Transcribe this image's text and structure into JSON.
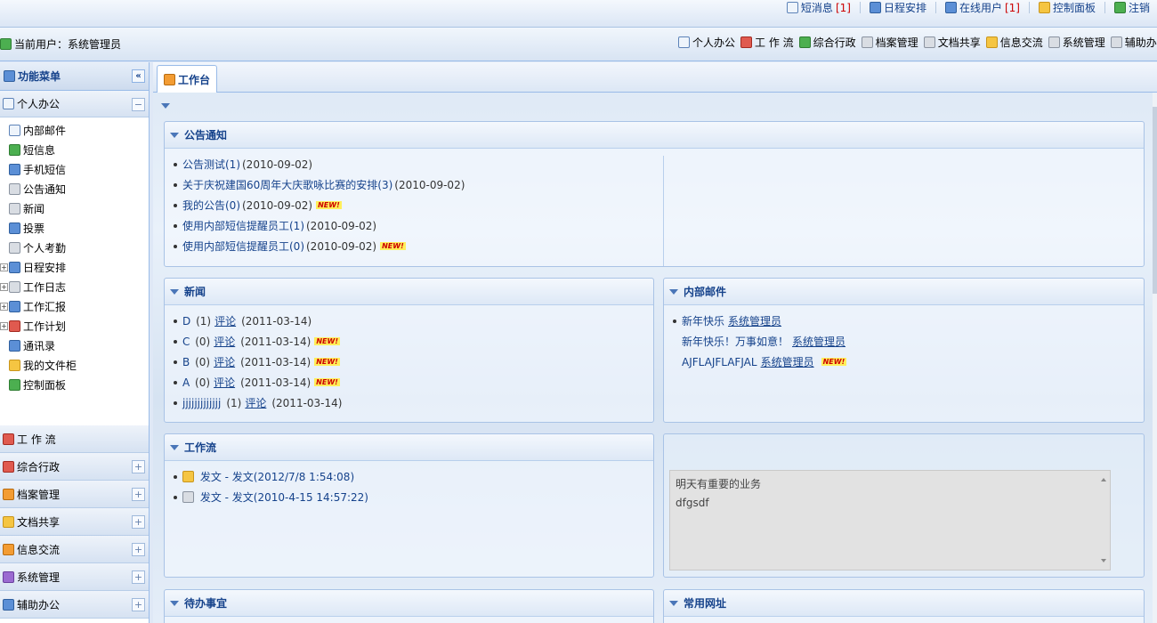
{
  "topbar": {
    "links": [
      {
        "label": "短消息",
        "count": "[1]",
        "icon": "envelope-icon"
      },
      {
        "label": "日程安排",
        "count": "",
        "icon": "calendar-icon"
      },
      {
        "label": "在线用户",
        "count": "[1]",
        "icon": "user-icon"
      },
      {
        "label": "控制面板",
        "count": "",
        "icon": "key-icon"
      },
      {
        "label": "注销",
        "count": "",
        "icon": "logout-icon"
      }
    ]
  },
  "userbar": {
    "current_user_label": "当前用户：系统管理员",
    "modules": [
      {
        "label": "个人办公",
        "icon": "mail-icon"
      },
      {
        "label": "工 作 流",
        "icon": "form-icon"
      },
      {
        "label": "综合行政",
        "icon": "people-icon"
      },
      {
        "label": "档案管理",
        "icon": "archive-icon"
      },
      {
        "label": "文档共享",
        "icon": "document-icon"
      },
      {
        "label": "信息交流",
        "icon": "chat-icon"
      },
      {
        "label": "系统管理",
        "icon": "gear-icon"
      },
      {
        "label": "辅助办公",
        "icon": "tools-icon"
      }
    ]
  },
  "sidebar": {
    "title": "功能菜单",
    "collapse_symbol": "«",
    "active_section": {
      "label": "个人办公",
      "toggle": "−"
    },
    "tree": [
      {
        "label": "内部邮件",
        "expand": "",
        "icon": "mail-icon"
      },
      {
        "label": "短信息",
        "expand": "",
        "icon": "chat-bubble-icon"
      },
      {
        "label": "手机短信",
        "expand": "",
        "icon": "phone-icon"
      },
      {
        "label": "公告通知",
        "expand": "",
        "icon": "bell-icon"
      },
      {
        "label": "新闻",
        "expand": "",
        "icon": "news-icon"
      },
      {
        "label": "投票",
        "expand": "",
        "icon": "vote-icon"
      },
      {
        "label": "个人考勤",
        "expand": "",
        "icon": "attendance-icon"
      },
      {
        "label": "日程安排",
        "expand": "+",
        "icon": "calendar-icon"
      },
      {
        "label": "工作日志",
        "expand": "+",
        "icon": "log-icon"
      },
      {
        "label": "工作汇报",
        "expand": "+",
        "icon": "report-icon"
      },
      {
        "label": "工作计划",
        "expand": "+",
        "icon": "plan-icon"
      },
      {
        "label": "通讯录",
        "expand": "",
        "icon": "contacts-icon"
      },
      {
        "label": "我的文件柜",
        "expand": "",
        "icon": "folder-icon"
      },
      {
        "label": "控制面板",
        "expand": "",
        "icon": "control-panel-icon"
      }
    ],
    "sections": [
      {
        "label": "工 作 流",
        "toggle": "",
        "icon": "form-icon"
      },
      {
        "label": "综合行政",
        "toggle": "+",
        "icon": "admin-icon"
      },
      {
        "label": "档案管理",
        "toggle": "+",
        "icon": "scale-icon"
      },
      {
        "label": "文档共享",
        "toggle": "+",
        "icon": "document-icon"
      },
      {
        "label": "信息交流",
        "toggle": "+",
        "icon": "briefcase-icon"
      },
      {
        "label": "系统管理",
        "toggle": "+",
        "icon": "tools-icon"
      },
      {
        "label": "辅助办公",
        "toggle": "+",
        "icon": "people-icon"
      }
    ]
  },
  "main": {
    "tab_label": "工作台",
    "portlets": {
      "announcements": {
        "title": "公告通知",
        "items": [
          {
            "text": "公告测试(1)",
            "date": "(2010-09-02)",
            "new": ""
          },
          {
            "text": "关于庆祝建国60周年大庆歌咏比赛的安排(3)",
            "date": "(2010-09-02)",
            "new": ""
          },
          {
            "text": "我的公告(0)",
            "date": "(2010-09-02)",
            "new": "NEW!"
          },
          {
            "text": "使用内部短信提醒员工(1)",
            "date": "(2010-09-02)",
            "new": ""
          },
          {
            "text": "使用内部短信提醒员工(0)",
            "date": "(2010-09-02)",
            "new": "NEW!"
          }
        ]
      },
      "news": {
        "title": "新闻",
        "items": [
          {
            "title": "D",
            "count": "(1)",
            "comment": "评论",
            "date": "(2011-03-14)",
            "new": ""
          },
          {
            "title": "C",
            "count": "(0)",
            "comment": "评论",
            "date": "(2011-03-14)",
            "new": "NEW!"
          },
          {
            "title": "B",
            "count": "(0)",
            "comment": "评论",
            "date": "(2011-03-14)",
            "new": "NEW!"
          },
          {
            "title": "A",
            "count": "(0)",
            "comment": "评论",
            "date": "(2011-03-14)",
            "new": "NEW!"
          },
          {
            "title": "jjjjjjjjjjjjj",
            "count": "(1)",
            "comment": "评论",
            "date": "(2011-03-14)",
            "new": ""
          }
        ]
      },
      "mail": {
        "title": "内部邮件",
        "items": [
          {
            "subject": "新年快乐",
            "sender": "系统管理员",
            "new": "",
            "bullet": true
          },
          {
            "subject": "新年快乐！万事如意！",
            "sender": "系统管理员",
            "new": "",
            "bullet": false
          },
          {
            "subject": "AJFLAJFLAFJAL",
            "sender": "系统管理员",
            "new": "NEW!",
            "bullet": false
          }
        ]
      },
      "workflow": {
        "title": "工作流",
        "items": [
          {
            "text": "发文 - 发文(2012/7/8 1:54:08)",
            "icon": "envelope-icon"
          },
          {
            "text": "发文 - 发文(2010-4-15 14:57:22)",
            "icon": "envelope-open-icon"
          }
        ]
      },
      "memo": {
        "lines": [
          "明天有重要的业务",
          "dfgsdf"
        ]
      },
      "todo": {
        "title": "待办事宜"
      },
      "links": {
        "title": "常用网址"
      }
    }
  }
}
